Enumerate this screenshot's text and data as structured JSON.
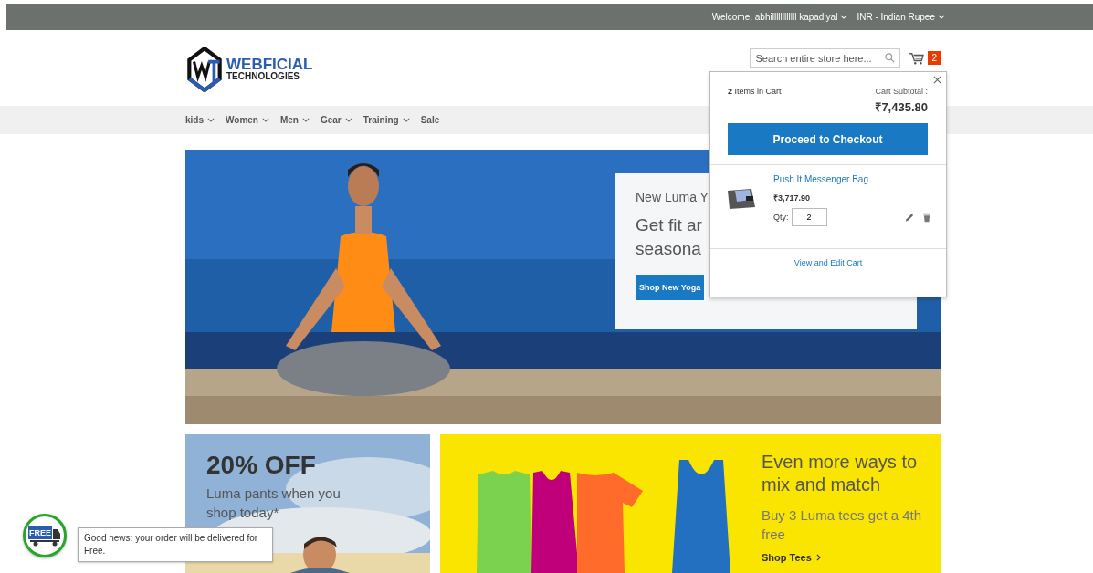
{
  "top_bar": {
    "welcome": "Welcome, abhillllllllllll kapadiyal",
    "currency": "INR - Indian Rupee"
  },
  "logo": {
    "name": "WEBFICIAL",
    "tagline": "TECHNOLOGIES"
  },
  "search": {
    "placeholder": "Search entire store here..."
  },
  "cart": {
    "count": "2"
  },
  "nav": [
    {
      "label": "kids",
      "dropdown": true
    },
    {
      "label": "Women",
      "dropdown": true
    },
    {
      "label": "Men",
      "dropdown": true
    },
    {
      "label": "Gear",
      "dropdown": true
    },
    {
      "label": "Training",
      "dropdown": true
    },
    {
      "label": "Sale",
      "dropdown": false
    }
  ],
  "hero": {
    "kind": "picture",
    "eyebrow": "New Luma Y",
    "headline_lines": [
      "Get fit ar",
      "seasona"
    ],
    "button": "Shop New Yoga"
  },
  "promos": [
    {
      "kind": "picture",
      "title": "20% OFF",
      "text": "Luma pants when you shop today*"
    },
    {
      "kind": "picture",
      "title": "Even more ways to mix and match",
      "text": "Buy 3 Luma tees get a 4th free",
      "link": "Shop Tees"
    }
  ],
  "minicart": {
    "count": "2",
    "count_label": "Items in Cart",
    "subtotal_label": "Cart Subtotal :",
    "subtotal": "₹7,435.80",
    "checkout": "Proceed to Checkout",
    "items": [
      {
        "name": "Push It Messenger Bag",
        "price": "₹3,717.90",
        "qty_label": "Qty:",
        "qty": "2"
      }
    ],
    "view_cart": "View and Edit Cart"
  },
  "shipping_notice": {
    "badge": "FREE",
    "message": "Good news: your order will be delivered for Free."
  }
}
